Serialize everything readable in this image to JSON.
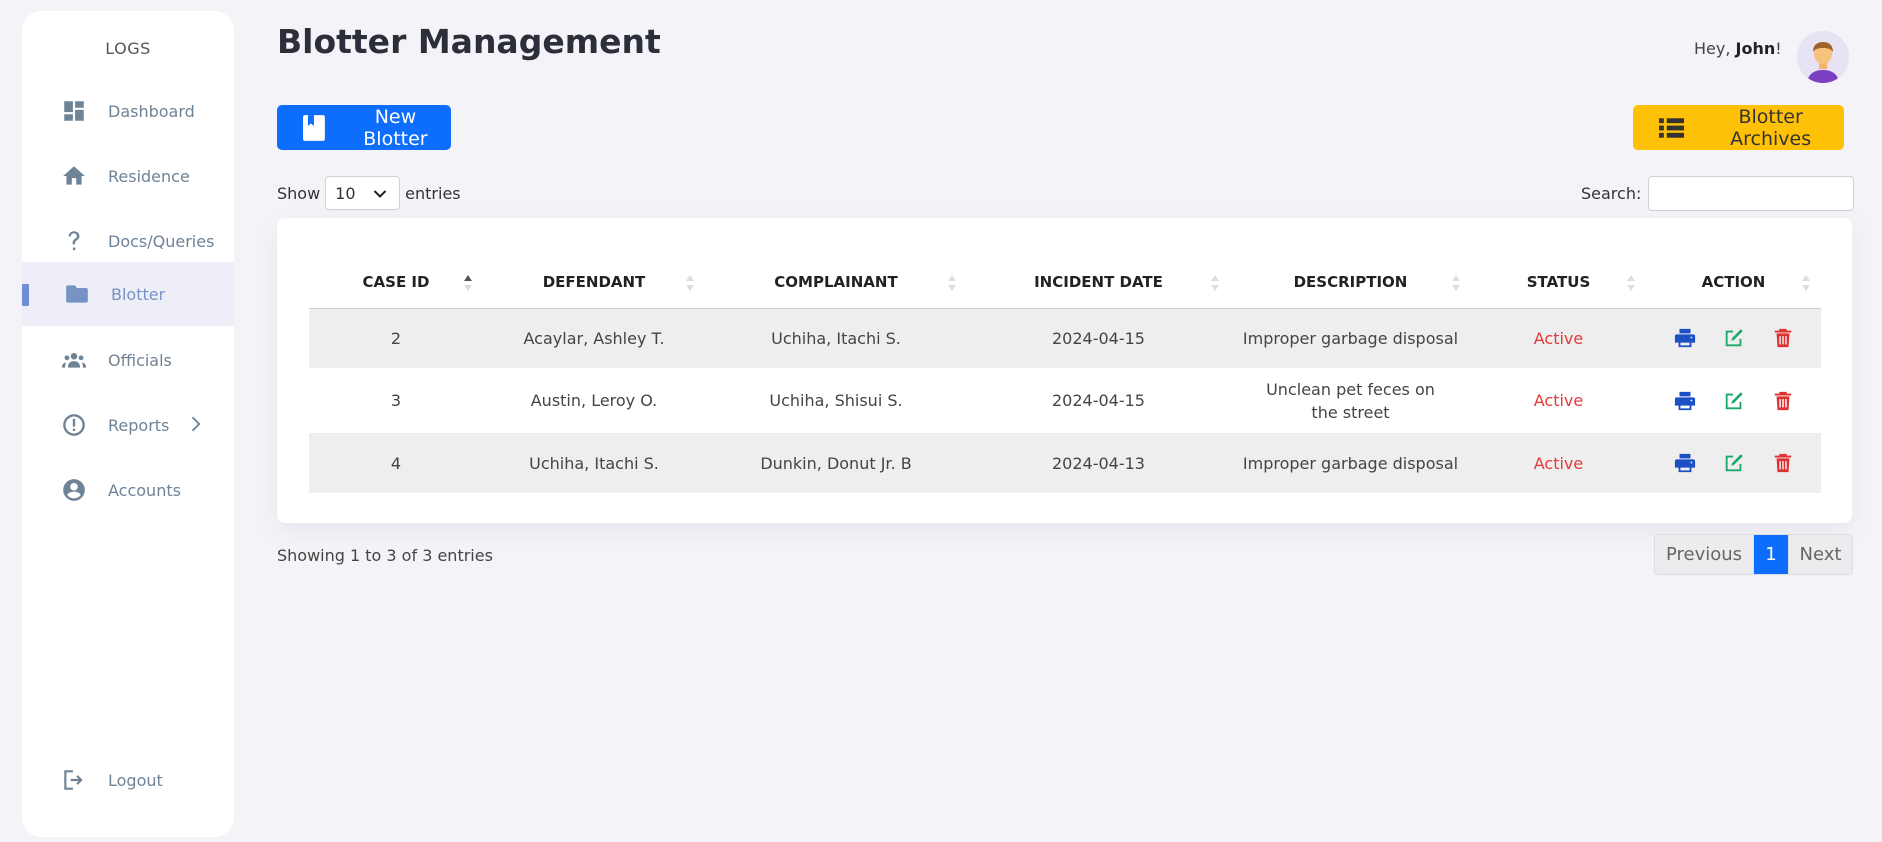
{
  "sidebar": {
    "brand": "LOGS",
    "items": [
      {
        "label": "Dashboard",
        "icon": "dashboard-icon"
      },
      {
        "label": "Residence",
        "icon": "home-icon"
      },
      {
        "label": "Docs/Queries",
        "icon": "question-icon"
      },
      {
        "label": "Blotter",
        "icon": "folder-icon",
        "active": true
      },
      {
        "label": "Officials",
        "icon": "people-icon"
      },
      {
        "label": "Reports",
        "icon": "exclamation-circle-icon"
      },
      {
        "label": "Accounts",
        "icon": "user-circle-icon"
      }
    ],
    "logout": {
      "label": "Logout",
      "icon": "logout-icon"
    }
  },
  "header": {
    "title": "Blotter Management",
    "greeting_prefix": "Hey, ",
    "user_name": "John",
    "greeting_suffix": "!"
  },
  "toolbar": {
    "new_label": "New Blotter",
    "archive_label": "Blotter Archives",
    "show_label": "Show",
    "entries_value": "10",
    "entries_label": "entries",
    "search_label": "Search:",
    "search_value": ""
  },
  "table": {
    "columns": [
      "CASE ID",
      "DEFENDANT",
      "COMPLAINANT",
      "INCIDENT DATE",
      "DESCRIPTION",
      "STATUS",
      "ACTION"
    ],
    "rows": [
      {
        "case_id": "2",
        "defendant": "Acaylar, Ashley T.",
        "complainant": "Uchiha, Itachi S.",
        "date": "2024-04-15",
        "description": "Improper garbage disposal",
        "status": "Active"
      },
      {
        "case_id": "3",
        "defendant": "Austin, Leroy O.",
        "complainant": "Uchiha, Shisui S.",
        "date": "2024-04-15",
        "description": "Unclean pet feces on the street",
        "status": "Active"
      },
      {
        "case_id": "4",
        "defendant": "Uchiha, Itachi S.",
        "complainant": "Dunkin, Donut Jr. B",
        "date": "2024-04-13",
        "description": "Improper garbage disposal",
        "status": "Active"
      }
    ]
  },
  "footer": {
    "showing": "Showing 1 to 3 of 3 entries",
    "prev": "Previous",
    "page": "1",
    "next": "Next"
  },
  "colors": {
    "primary": "#0d6efd",
    "warning": "#ffc107",
    "status_active": "#e63939",
    "print_icon": "#1d4fc4",
    "edit_icon": "#1aa86b",
    "delete_icon": "#e03131"
  }
}
